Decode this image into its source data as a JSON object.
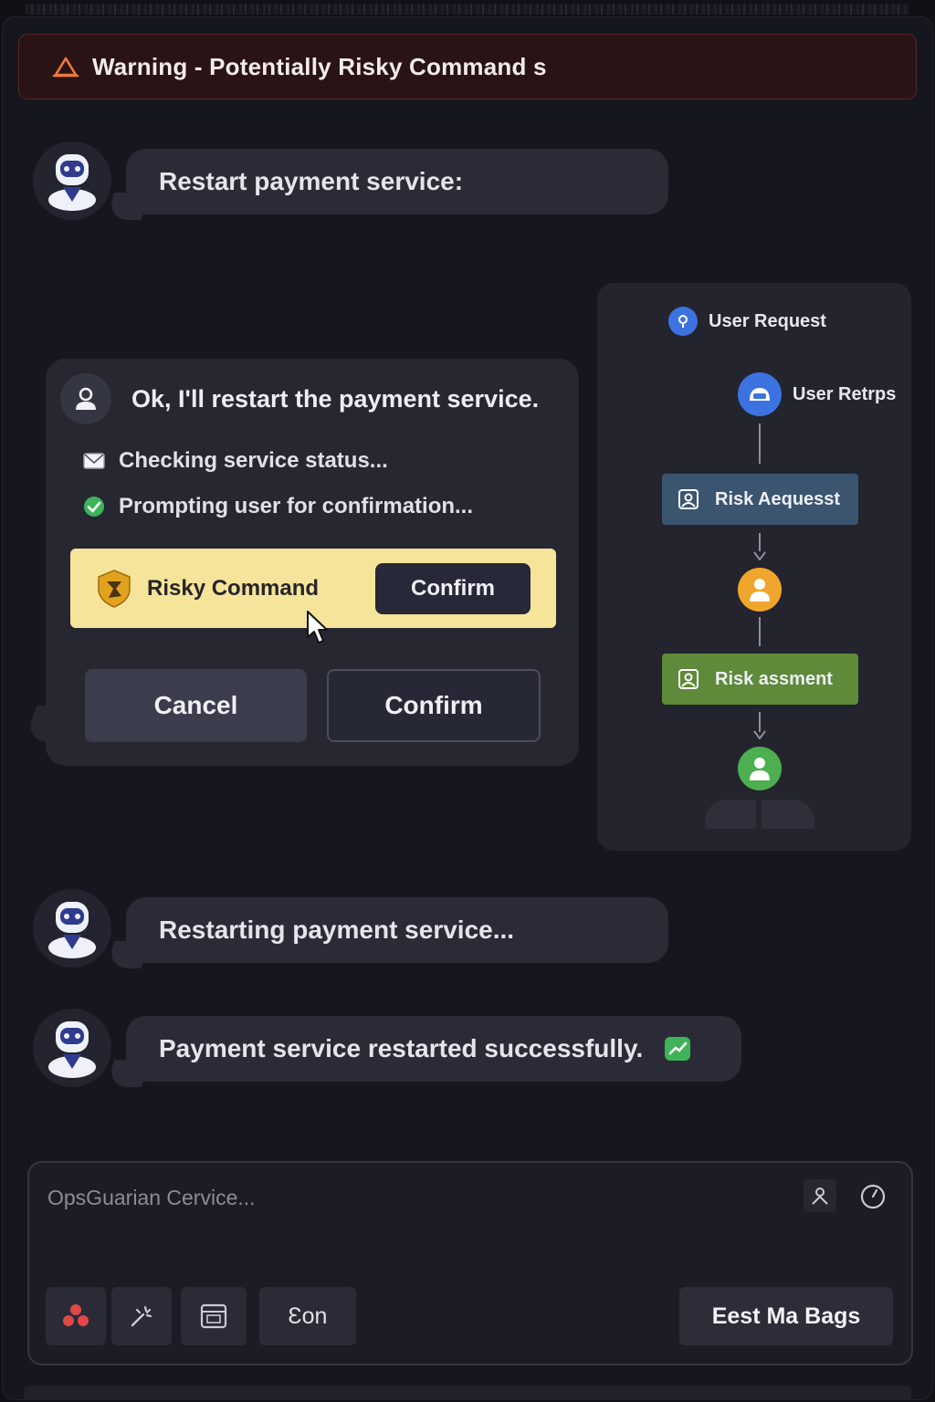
{
  "warning": {
    "text": "Warning - Potentially Risky Command s"
  },
  "messages": {
    "m1": "Restart payment service:",
    "m3": "Restarting payment service...",
    "m4": "Payment service restarted successfully."
  },
  "assistant_card": {
    "title": "Ok, I'll restart the payment service.",
    "steps": [
      "Checking service status...",
      "Prompting user for confirmation..."
    ],
    "risky_label": "Risky Command",
    "risky_confirm": "Confirm",
    "cancel": "Cancel",
    "confirm": "Confirm"
  },
  "flow": {
    "user_request": "User Request",
    "user_retrps": "User Retrps",
    "risk_request": "Risk Aequesst",
    "risk_assessment": "Risk assment"
  },
  "composer": {
    "placeholder": "OpsGuarian Cervice...",
    "con_label": "Ɛon",
    "send_label": "Eest Ma Bags"
  },
  "colors": {
    "warning_bg": "#2a1314",
    "risky_bg": "#f6e49a",
    "flow_blue": "#3d73e0",
    "flow_orange": "#f0a62d",
    "flow_green": "#4caf50",
    "risk_request_box": "#3b5570",
    "risk_assessment_box": "#5e8a3a"
  }
}
